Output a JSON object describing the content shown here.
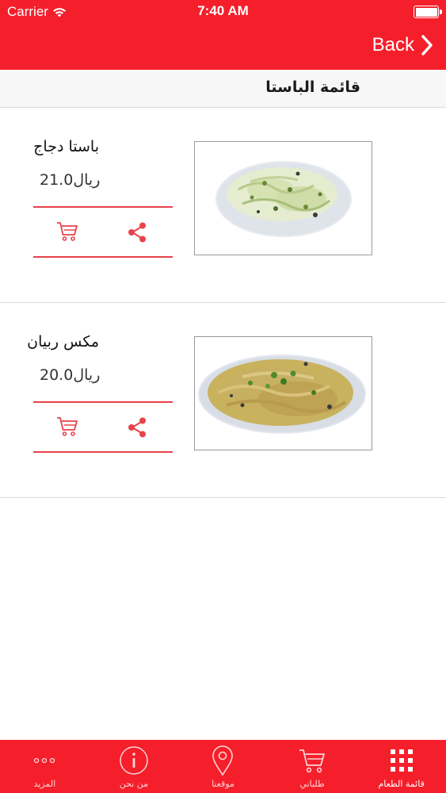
{
  "status_bar": {
    "carrier": "Carrier",
    "time": "7:40 AM"
  },
  "nav": {
    "back_label": "Back"
  },
  "page": {
    "title": "قائمة الباستا"
  },
  "colors": {
    "brand": "#f41f2b",
    "divider_accent": "#e8434c"
  },
  "items": [
    {
      "name": "باستا دجاج",
      "price": "21.0",
      "currency": "ريال",
      "image_icon": "pasta-chicken-photo",
      "cart_icon": "cart-icon",
      "share_icon": "share-icon"
    },
    {
      "name": "مكس ربيان",
      "price": "20.0",
      "currency": "ريال",
      "image_icon": "shrimp-mix-photo",
      "cart_icon": "cart-icon",
      "share_icon": "share-icon"
    }
  ],
  "tabs": [
    {
      "label": "المزيد",
      "icon": "more-dots-icon",
      "active": false
    },
    {
      "label": "من نحن",
      "icon": "info-icon",
      "active": false
    },
    {
      "label": "موقعنا",
      "icon": "location-pin-icon",
      "active": false
    },
    {
      "label": "طلباتي",
      "icon": "cart-icon",
      "active": false
    },
    {
      "label": "قائمة الطعام",
      "icon": "grid-icon",
      "active": true
    }
  ]
}
